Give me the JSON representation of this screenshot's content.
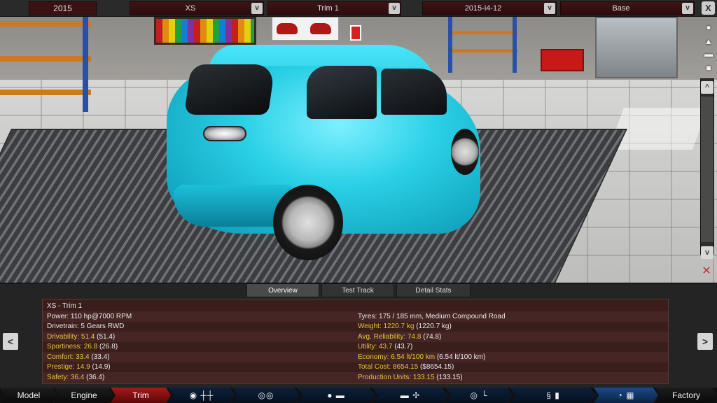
{
  "topbar": {
    "year": "2015",
    "model_select": "XS",
    "trim_select": "Trim 1",
    "engine_select": "2015-i4-12",
    "variant_select": "Base",
    "dropdown_glyph": "v",
    "close_glyph": "X"
  },
  "tabs": [
    {
      "label": "Overview"
    },
    {
      "label": "Test Track"
    },
    {
      "label": "Detail Stats"
    }
  ],
  "stats": {
    "title": "XS - Trim 1",
    "left": [
      {
        "label": "Power: 110 hp@7000 RPM"
      },
      {
        "label": "Drivetrain: 5 Gears RWD"
      },
      {
        "label": "Drivability: 51.4",
        "extra": " (51.4)"
      },
      {
        "label": "Sportiness: 26.8",
        "extra": " (26.8)"
      },
      {
        "label": "Comfort: 33.4",
        "extra": " (33.4)"
      },
      {
        "label": "Prestige: 14.9",
        "extra": " (14.9)"
      },
      {
        "label": "Safety: 36.4",
        "extra": " (36.4)"
      }
    ],
    "right": [
      {
        "label": "Tyres: 175 / 185 mm, Medium Compound Road"
      },
      {
        "label": "Weight: 1220.7 kg",
        "extra": " (1220.7 kg)"
      },
      {
        "label": "Avg. Reliability: 74.8",
        "extra": " (74.8)"
      },
      {
        "label": "Utility: 43.7",
        "extra": " (43.7)"
      },
      {
        "label": "Economy: 6.54 lt/100 km",
        "extra": " (6.54 lt/100 km)"
      },
      {
        "label": "Total Cost: 8654.15",
        "extra": " ($8654.15)"
      },
      {
        "label": "Production Units: 133.15",
        "extra": " (133.15)"
      }
    ]
  },
  "arrows": {
    "prev": "<",
    "next": ">"
  },
  "nav": {
    "model": "Model",
    "engine": "Engine",
    "trim": "Trim",
    "factory": "Factory"
  },
  "scroll": {
    "up": "^",
    "down": "v"
  },
  "colors": {
    "accent_red": "#a81818",
    "stat_yellow": "#e6c33a",
    "car_cyan": "#2ad0e6"
  }
}
